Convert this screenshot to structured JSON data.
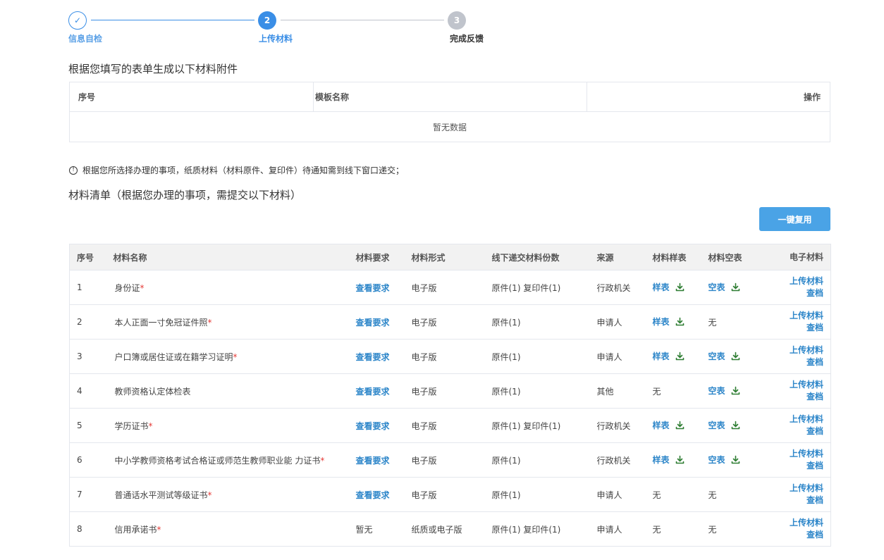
{
  "steps": [
    {
      "num": "✓",
      "label": "信息自检"
    },
    {
      "num": "2",
      "label": "上传材料"
    },
    {
      "num": "3",
      "label": "完成反馈"
    }
  ],
  "template_section": {
    "title": "根据您填写的表单生成以下材料附件",
    "headers": [
      "序号",
      "模板名称",
      "操作"
    ],
    "empty_text": "暂无数据"
  },
  "notice": "根据您所选择办理的事项，纸质材料（材料原件、复印件）待通知需到线下窗口递交；",
  "materials_section": {
    "title": "材料清单（根据您办理的事项，需提交以下材料）",
    "reuse_button": "一键复用",
    "headers": [
      "序号",
      "材料名称",
      "材料要求",
      "材料形式",
      "线下递交材料份数",
      "来源",
      "材料样表",
      "材料空表",
      "电子材料"
    ],
    "upload_label": "上传材料",
    "view_label": "查档",
    "rows": [
      {
        "no": "1",
        "name": "身份证",
        "required": "*",
        "req": "查看要求",
        "req_link": true,
        "form": "电子版",
        "copies": "原件(1) 复印件(1)",
        "source": "行政机关",
        "sample": "样表",
        "sample_link": true,
        "blank": "空表",
        "blank_link": true
      },
      {
        "no": "2",
        "name": "本人正面一寸免冠证件照",
        "required": "*",
        "req": "查看要求",
        "req_link": true,
        "form": "电子版",
        "copies": "原件(1)",
        "source": "申请人",
        "sample": "样表",
        "sample_link": true,
        "blank": "无",
        "blank_link": false
      },
      {
        "no": "3",
        "name": "户口簿或居住证或在籍学习证明",
        "required": "*",
        "req": "查看要求",
        "req_link": true,
        "form": "电子版",
        "copies": "原件(1)",
        "source": "申请人",
        "sample": "样表",
        "sample_link": true,
        "blank": "空表",
        "blank_link": true
      },
      {
        "no": "4",
        "name": "教师资格认定体检表",
        "required": "",
        "req": "查看要求",
        "req_link": true,
        "form": "电子版",
        "copies": "原件(1)",
        "source": "其他",
        "sample": "无",
        "sample_link": false,
        "blank": "空表",
        "blank_link": true
      },
      {
        "no": "5",
        "name": "学历证书",
        "required": "*",
        "req": "查看要求",
        "req_link": true,
        "form": "电子版",
        "copies": "原件(1) 复印件(1)",
        "source": "行政机关",
        "sample": "样表",
        "sample_link": true,
        "blank": "空表",
        "blank_link": true
      },
      {
        "no": "6",
        "name": "中小学教师资格考试合格证或师范生教师职业能 力证书",
        "required": "*",
        "req": "查看要求",
        "req_link": true,
        "form": "电子版",
        "copies": "原件(1)",
        "source": "行政机关",
        "sample": "样表",
        "sample_link": true,
        "blank": "空表",
        "blank_link": true
      },
      {
        "no": "7",
        "name": "普通话水平测试等级证书",
        "required": "*",
        "req": "查看要求",
        "req_link": true,
        "form": "电子版",
        "copies": "原件(1)",
        "source": "申请人",
        "sample": "无",
        "sample_link": false,
        "blank": "无",
        "blank_link": false
      },
      {
        "no": "8",
        "name": "信用承诺书",
        "required": "*",
        "req": "暂无",
        "req_link": false,
        "form": "纸质或电子版",
        "copies": "原件(1) 复印件(1)",
        "source": "申请人",
        "sample": "无",
        "sample_link": false,
        "blank": "无",
        "blank_link": false
      }
    ]
  },
  "colors": {
    "primary": "#3a8ee6",
    "link": "#2d86c9",
    "download": "#2e7d32",
    "required": "#e53935",
    "inactive": "#c0c4cc"
  },
  "icons": {
    "download": "download-icon",
    "info": "info-icon",
    "check": "check-icon"
  }
}
